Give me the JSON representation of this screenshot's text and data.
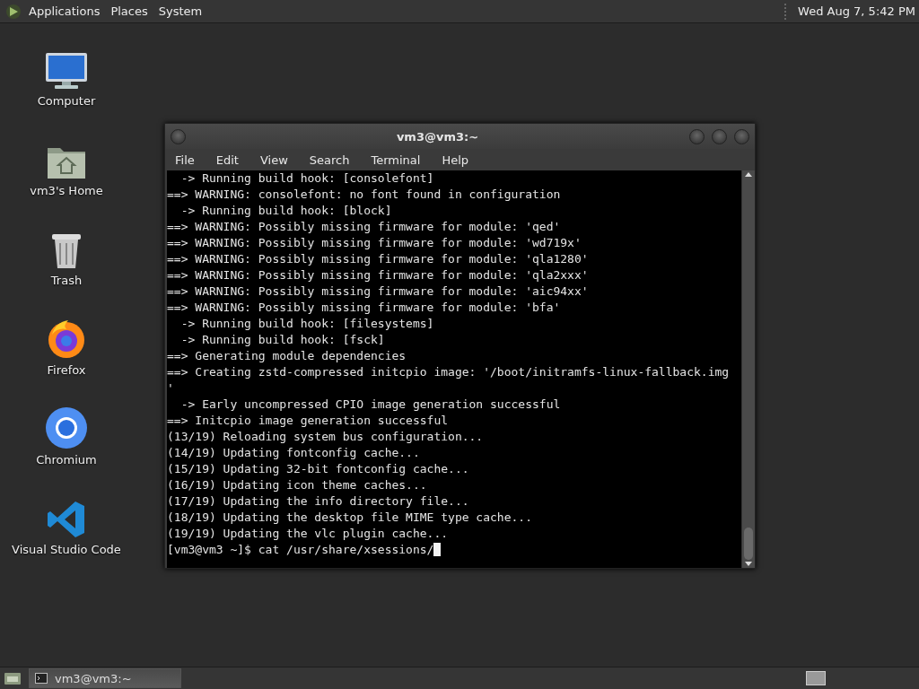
{
  "top_panel": {
    "menus": [
      "Applications",
      "Places",
      "System"
    ],
    "clock": "Wed Aug  7,  5:42 PM"
  },
  "desktop_icons": [
    {
      "kind": "computer",
      "label": "Computer"
    },
    {
      "kind": "home",
      "label": "vm3's Home"
    },
    {
      "kind": "trash",
      "label": "Trash"
    },
    {
      "kind": "firefox",
      "label": "Firefox"
    },
    {
      "kind": "chromium",
      "label": "Chromium"
    },
    {
      "kind": "vscode",
      "label": "Visual Studio Code"
    }
  ],
  "terminal_window": {
    "title": "vm3@vm3:~",
    "menu": [
      "File",
      "Edit",
      "View",
      "Search",
      "Terminal",
      "Help"
    ],
    "lines": [
      "  -> Running build hook: [consolefont]",
      "==> WARNING: consolefont: no font found in configuration",
      "  -> Running build hook: [block]",
      "==> WARNING: Possibly missing firmware for module: 'qed'",
      "==> WARNING: Possibly missing firmware for module: 'wd719x'",
      "==> WARNING: Possibly missing firmware for module: 'qla1280'",
      "==> WARNING: Possibly missing firmware for module: 'qla2xxx'",
      "==> WARNING: Possibly missing firmware for module: 'aic94xx'",
      "==> WARNING: Possibly missing firmware for module: 'bfa'",
      "  -> Running build hook: [filesystems]",
      "  -> Running build hook: [fsck]",
      "==> Generating module dependencies",
      "==> Creating zstd-compressed initcpio image: '/boot/initramfs-linux-fallback.img",
      "'",
      "  -> Early uncompressed CPIO image generation successful",
      "==> Initcpio image generation successful",
      "(13/19) Reloading system bus configuration...",
      "(14/19) Updating fontconfig cache...",
      "(15/19) Updating 32-bit fontconfig cache...",
      "(16/19) Updating icon theme caches...",
      "(17/19) Updating the info directory file...",
      "(18/19) Updating the desktop file MIME type cache...",
      "(19/19) Updating the vlc plugin cache..."
    ],
    "prompt": "[vm3@vm3 ~]$ cat /usr/share/xsessions/"
  },
  "bottom_panel": {
    "tasks": [
      {
        "label": "vm3@vm3:~",
        "selected": true
      }
    ]
  }
}
